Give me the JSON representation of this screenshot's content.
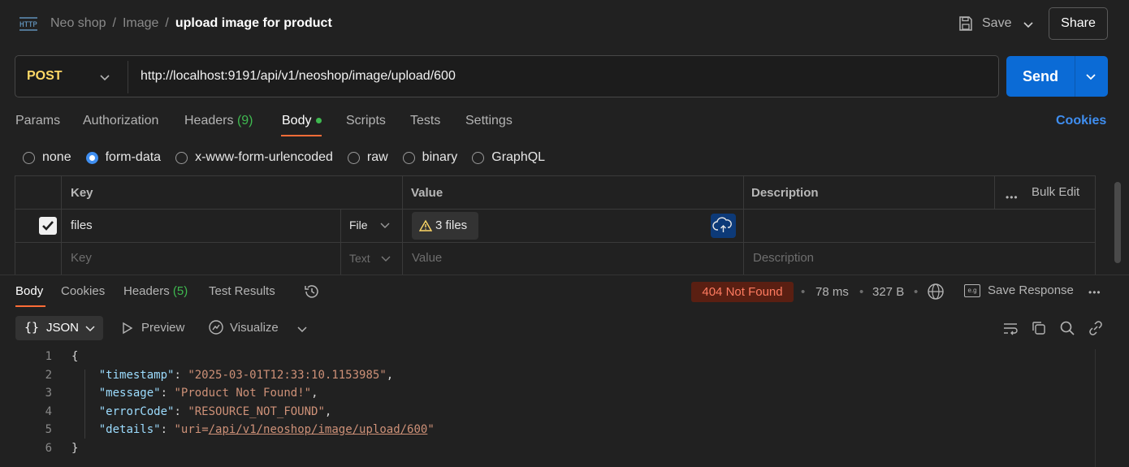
{
  "header": {
    "logo_icon": "http-icon",
    "breadcrumb": [
      "Neo shop",
      "Image",
      "upload image for product"
    ],
    "save_label": "Save",
    "share_label": "Share"
  },
  "request": {
    "method": "POST",
    "url": "http://localhost:9191/api/v1/neoshop/image/upload/600",
    "send_label": "Send"
  },
  "request_tabs": [
    {
      "label": "Params",
      "count": ""
    },
    {
      "label": "Authorization",
      "count": ""
    },
    {
      "label": "Headers",
      "count": "(9)"
    },
    {
      "label": "Body",
      "count": ""
    },
    {
      "label": "Scripts",
      "count": ""
    },
    {
      "label": "Tests",
      "count": ""
    },
    {
      "label": "Settings",
      "count": ""
    }
  ],
  "active_request_tab": "Body",
  "cookies_label": "Cookies",
  "body_types": [
    "none",
    "form-data",
    "x-www-form-urlencoded",
    "raw",
    "binary",
    "GraphQL"
  ],
  "selected_body_type": "form-data",
  "form_table": {
    "headers": {
      "key": "Key",
      "value": "Value",
      "description": "Description",
      "bulk_edit": "Bulk Edit"
    },
    "rows": [
      {
        "checked": true,
        "key": "files",
        "type": "File",
        "value": "3 files",
        "description": ""
      }
    ],
    "placeholder_row": {
      "key": "Key",
      "type": "Text",
      "value": "Value",
      "description": "Description"
    }
  },
  "response_tabs": [
    {
      "label": "Body",
      "count": ""
    },
    {
      "label": "Cookies",
      "count": ""
    },
    {
      "label": "Headers",
      "count": "(5)"
    },
    {
      "label": "Test Results",
      "count": ""
    }
  ],
  "active_response_tab": "Body",
  "response_meta": {
    "status": "404 Not Found",
    "time": "78 ms",
    "size": "327 B",
    "save_response_label": "Save Response"
  },
  "response_toolbar": {
    "format_label": "JSON",
    "preview_label": "Preview",
    "visualize_label": "Visualize"
  },
  "response_body": {
    "line_numbers": [
      "1",
      "2",
      "3",
      "4",
      "5",
      "6"
    ],
    "open_brace": "{",
    "close_brace": "}",
    "fields": [
      {
        "key": "timestamp",
        "value": "2025-03-01T12:33:10.1153985"
      },
      {
        "key": "message",
        "value": "Product Not Found!"
      },
      {
        "key": "errorCode",
        "value": "RESOURCE_NOT_FOUND"
      },
      {
        "key": "details",
        "value_prefix": "uri=",
        "value_link": "/api/v1/neoshop/image/upload/600"
      }
    ]
  },
  "colors": {
    "accent": "#ff6c37",
    "send_button": "#0b6bd6",
    "status_error_bg": "#5a1f12",
    "status_error_text": "#ff7b60"
  }
}
